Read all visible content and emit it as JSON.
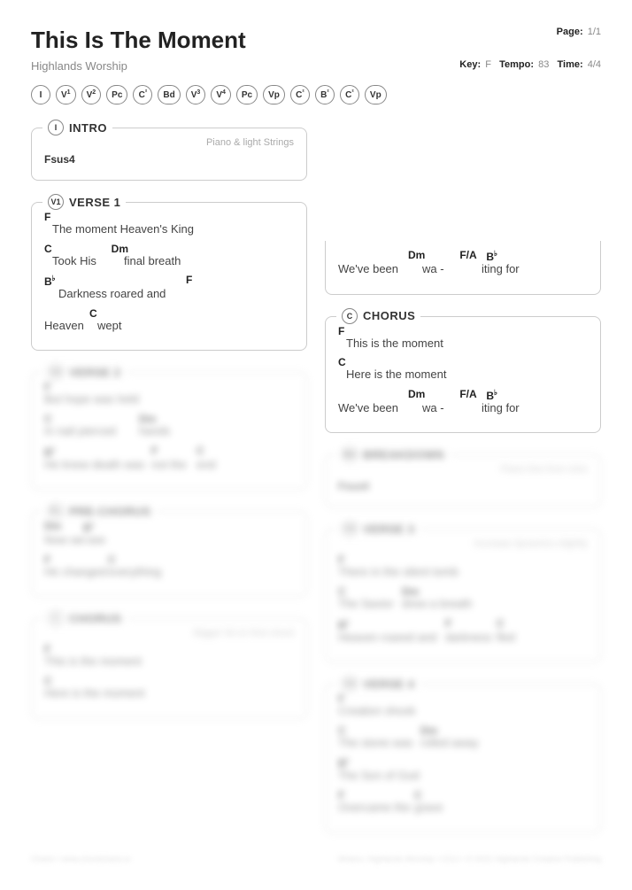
{
  "header": {
    "title": "This Is The Moment",
    "artist": "Highlands Worship",
    "page_label": "Page:",
    "page_value": "1/1",
    "key_label": "Key:",
    "key_value": "F",
    "tempo_label": "Tempo:",
    "tempo_value": "83",
    "time_label": "Time:",
    "time_value": "4/4"
  },
  "nav": [
    "I",
    "V1",
    "V2",
    "Pc",
    "C²",
    "Bd",
    "V3",
    "V4",
    "Pc",
    "Vp",
    "C²",
    "B²",
    "C²",
    "Vp"
  ],
  "sections": {
    "intro": {
      "badge": "I",
      "title": "INTRO",
      "note": "Piano & light Strings",
      "chord": "Fsus4"
    },
    "verse1": {
      "badge": "V1",
      "title": "VERSE 1",
      "lines": [
        {
          "chords": [
            "F",
            ""
          ],
          "lyrics": [
            "",
            "The moment Heaven's King"
          ]
        },
        {
          "chords": [
            "C",
            "",
            "Dm",
            ""
          ],
          "lyrics": [
            "",
            "Took His ",
            "",
            "final breath"
          ]
        },
        {
          "chords": [
            "B♭",
            "",
            "",
            "F"
          ],
          "lyrics": [
            "",
            "Darkness roared and",
            ""
          ]
        },
        {
          "chords": [
            "",
            "C",
            ""
          ],
          "lyrics": [
            "Heaven ",
            "",
            "wept"
          ]
        }
      ]
    },
    "verse2": {
      "badge": "V2",
      "title": "VERSE 2",
      "lines": [
        {
          "chords": [
            "F"
          ],
          "lyrics": [
            "But hope was held"
          ]
        },
        {
          "chords": [
            "C",
            "Dm"
          ],
          "lyrics": [
            "In nail pierced",
            "hands"
          ]
        },
        {
          "chords": [
            "B♭",
            "F",
            "C"
          ],
          "lyrics": [
            "He knew death was",
            "not the",
            "end"
          ]
        }
      ]
    },
    "prechorus": {
      "badge": "Pc",
      "title": "PRE-CHORUS",
      "lines": [
        {
          "chords": [
            "Dm",
            "B♭"
          ],
          "lyrics": [
            "Now we",
            "see"
          ]
        },
        {
          "chords": [
            "F",
            "C"
          ],
          "lyrics": [
            "He changed",
            "everything"
          ]
        }
      ]
    },
    "chorus_blur": {
      "badge": "C",
      "title": "CHORUS",
      "note": "Bigger hit on first chord",
      "lines": [
        {
          "chords": [
            "F"
          ],
          "lyrics": [
            "This is the moment"
          ]
        },
        {
          "chords": [
            "C"
          ],
          "lyrics": [
            "Here is the moment"
          ]
        }
      ]
    },
    "partial_top": {
      "lines": [
        {
          "chords": [
            "",
            "Dm",
            "",
            "F/A ",
            "B♭"
          ],
          "lyrics": [
            "We've been ",
            "",
            "wa - ",
            "",
            "iting  for"
          ]
        }
      ]
    },
    "chorus": {
      "badge": "C",
      "title": "CHORUS",
      "lines": [
        {
          "chords": [
            "F",
            ""
          ],
          "lyrics": [
            "",
            "This is the moment"
          ]
        },
        {
          "chords": [
            "C",
            ""
          ],
          "lyrics": [
            "",
            "Here is the moment"
          ]
        },
        {
          "chords": [
            "",
            "Dm",
            "",
            "F/A ",
            "B♭"
          ],
          "lyrics": [
            "We've been ",
            "",
            "wa - ",
            "",
            "iting  for"
          ]
        }
      ]
    },
    "breakdown": {
      "badge": "Bd",
      "title": "BREAKDOWN",
      "note": "Piano line from Intro",
      "chord": "Fsus4"
    },
    "verse3": {
      "badge": "V3",
      "title": "VERSE 3",
      "note": "Increase dynamics slightly",
      "lines": [
        {
          "chords": [
            "F"
          ],
          "lyrics": [
            "There in the silent tomb"
          ]
        },
        {
          "chords": [
            "C",
            "Dm"
          ],
          "lyrics": [
            "The Savior",
            "drew a breath"
          ]
        },
        {
          "chords": [
            "B♭",
            "F",
            "C"
          ],
          "lyrics": [
            "Heaven roared and",
            "darkness",
            "fled"
          ]
        }
      ]
    },
    "verse4": {
      "badge": "V4",
      "title": "VERSE 4",
      "lines": [
        {
          "chords": [
            "F"
          ],
          "lyrics": [
            "Creation shook"
          ]
        },
        {
          "chords": [
            "C",
            "Dm"
          ],
          "lyrics": [
            "The stone was",
            "rolled away"
          ]
        },
        {
          "chords": [
            "B♭"
          ],
          "lyrics": [
            "The Son of God"
          ]
        },
        {
          "chords": [
            "F",
            "C"
          ],
          "lyrics": [
            "Overcame the",
            "grave"
          ]
        }
      ]
    }
  },
  "footer": {
    "left": "Charts • www.chordcharts.io",
    "right": "Writers: Highlands Worship • CCLI • © 2021 Highlands Creative Publishing"
  }
}
